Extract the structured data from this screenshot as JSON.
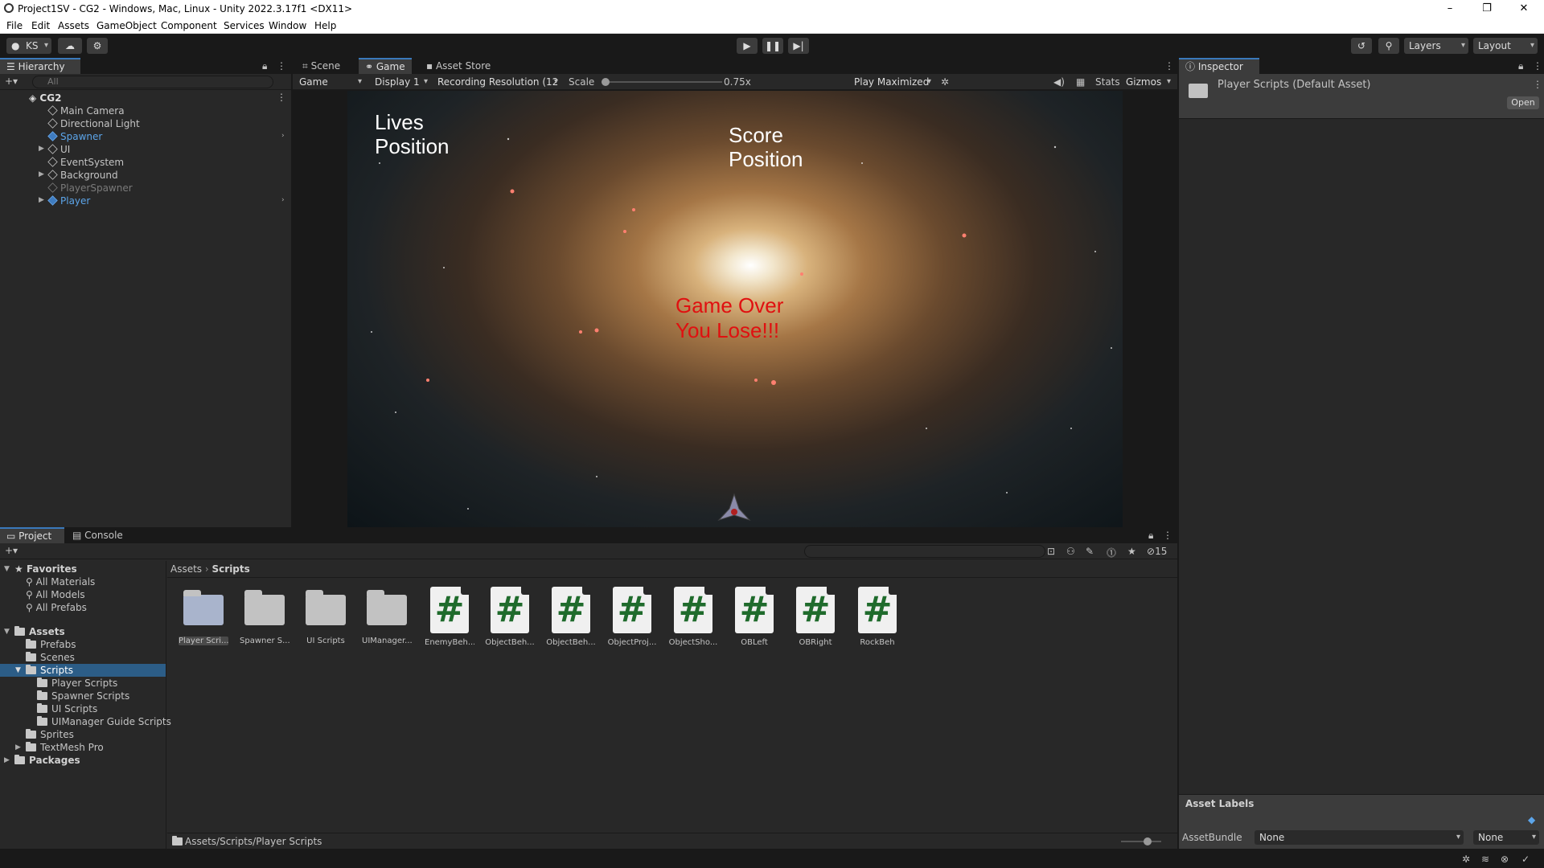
{
  "window": {
    "title": "Project1SV - CG2 - Windows, Mac, Linux - Unity 2022.3.17f1 <DX11>",
    "minimize": "–",
    "maximize": "❐",
    "close": "✕"
  },
  "menu": [
    "File",
    "Edit",
    "Assets",
    "GameObject",
    "Component",
    "Services",
    "Window",
    "Help"
  ],
  "toolbar": {
    "account": "KS",
    "layers": "Layers",
    "layout": "Layout"
  },
  "hierarchy": {
    "tab": "Hierarchy",
    "search_placeholder": "All",
    "scene": "CG2",
    "items": [
      {
        "label": "Main Camera",
        "color": "#c4c4c4"
      },
      {
        "label": "Directional Light",
        "color": "#c4c4c4"
      },
      {
        "label": "Spawner",
        "color": "#5ca5ea"
      },
      {
        "label": "UI",
        "color": "#c4c4c4"
      },
      {
        "label": "EventSystem",
        "color": "#c4c4c4"
      },
      {
        "label": "Background",
        "color": "#c4c4c4"
      },
      {
        "label": "PlayerSpawner",
        "color": "#7a7a7a"
      },
      {
        "label": "Player",
        "color": "#5ca5ea"
      }
    ]
  },
  "view_tabs": {
    "scene": "Scene",
    "game": "Game",
    "asset_store": "Asset Store"
  },
  "game_bar": {
    "mode": "Game",
    "display": "Display 1",
    "resolution": "Recording Resolution (12",
    "scale_label": "Scale",
    "scale_value": "0.75x",
    "scale_fraction": 0,
    "play_mode": "Play Maximized",
    "stats": "Stats",
    "gizmos": "Gizmos"
  },
  "game_view": {
    "lives": "Lives\nPosition",
    "score": "Score\nPosition",
    "game_over_line1": "Game Over",
    "game_over_line2": "You Lose!!!"
  },
  "inspector": {
    "tab": "Inspector",
    "asset_title": "Player Scripts (Default Asset)",
    "open_button": "Open",
    "asset_labels": "Asset Labels",
    "assetbundle_label": "AssetBundle",
    "assetbundle_value": "None",
    "variant_value": "None"
  },
  "project": {
    "tab_project": "Project",
    "tab_console": "Console",
    "hidden_count": "15",
    "favorites": "Favorites",
    "favorite_items": [
      "All Materials",
      "All Models",
      "All Prefabs"
    ],
    "assets_root": "Assets",
    "asset_folders": [
      "Prefabs",
      "Scenes",
      "Scripts"
    ],
    "script_subfolders": [
      "Player Scripts",
      "Spawner Scripts",
      "UI Scripts",
      "UIManager Guide Scripts"
    ],
    "more_folders": [
      "Sprites",
      "TextMesh Pro"
    ],
    "packages": "Packages",
    "breadcrumb_root": "Assets",
    "breadcrumb_current": "Scripts",
    "grid_folders": [
      "Player Scri...",
      "Spawner S...",
      "UI Scripts",
      "UIManager..."
    ],
    "grid_scripts": [
      "EnemyBeh...",
      "ObjectBeh...",
      "ObjectBeh...",
      "ObjectProj...",
      "ObjectSho...",
      "OBLeft",
      "OBRight",
      "RockBeh"
    ],
    "script_glyph": "#",
    "status_path": "Assets/Scripts/Player Scripts"
  }
}
